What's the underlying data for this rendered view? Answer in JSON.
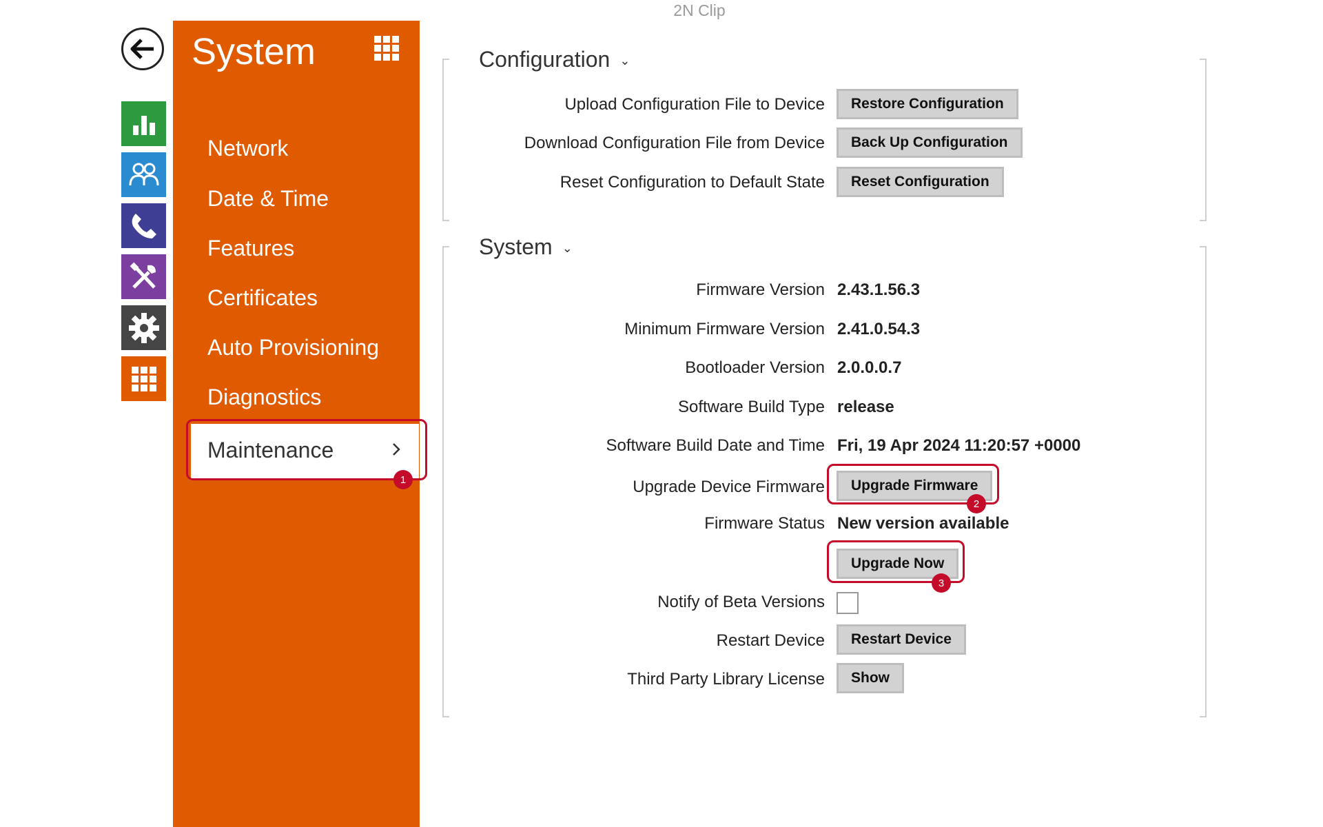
{
  "app": {
    "title": "2N Clip"
  },
  "rail": {
    "items": [
      {
        "name": "status",
        "color": "#2e9a3f"
      },
      {
        "name": "directory",
        "color": "#2a8bd0"
      },
      {
        "name": "calls",
        "color": "#3e3f94"
      },
      {
        "name": "hardware",
        "color": "#7c3fa0"
      },
      {
        "name": "services",
        "color": "#454545"
      },
      {
        "name": "system",
        "color": "#e05a00"
      }
    ]
  },
  "sidebar": {
    "title": "System",
    "items": [
      {
        "label": "Network"
      },
      {
        "label": "Date & Time"
      },
      {
        "label": "Features"
      },
      {
        "label": "Certificates"
      },
      {
        "label": "Auto Provisioning"
      },
      {
        "label": "Diagnostics"
      }
    ],
    "active": "Maintenance"
  },
  "callouts": {
    "one": "1",
    "two": "2",
    "three": "3"
  },
  "configuration": {
    "title": "Configuration",
    "rows": [
      {
        "label": "Upload Configuration File to Device",
        "button": "Restore Configuration"
      },
      {
        "label": "Download Configuration File from Device",
        "button": "Back Up Configuration"
      },
      {
        "label": "Reset Configuration to Default State",
        "button": "Reset Configuration"
      }
    ]
  },
  "system": {
    "title": "System",
    "firmware_version": {
      "label": "Firmware Version",
      "value": "2.43.1.56.3"
    },
    "min_firmware_version": {
      "label": "Minimum Firmware Version",
      "value": "2.41.0.54.3"
    },
    "bootloader_version": {
      "label": "Bootloader Version",
      "value": "2.0.0.0.7"
    },
    "build_type": {
      "label": "Software Build Type",
      "value": "release"
    },
    "build_date": {
      "label": "Software Build Date and Time",
      "value": "Fri, 19 Apr 2024 11:20:57 +0000"
    },
    "upgrade_firmware": {
      "label": "Upgrade Device Firmware",
      "button": "Upgrade Firmware"
    },
    "firmware_status": {
      "label": "Firmware Status",
      "value": "New version available"
    },
    "upgrade_now": {
      "button": "Upgrade Now"
    },
    "beta": {
      "label": "Notify of Beta Versions",
      "checked": false
    },
    "restart": {
      "label": "Restart Device",
      "button": "Restart Device"
    },
    "license": {
      "label": "Third Party Library License",
      "button": "Show"
    }
  },
  "colors": {
    "accent": "#e05a00",
    "callout": "#c40c2a"
  }
}
